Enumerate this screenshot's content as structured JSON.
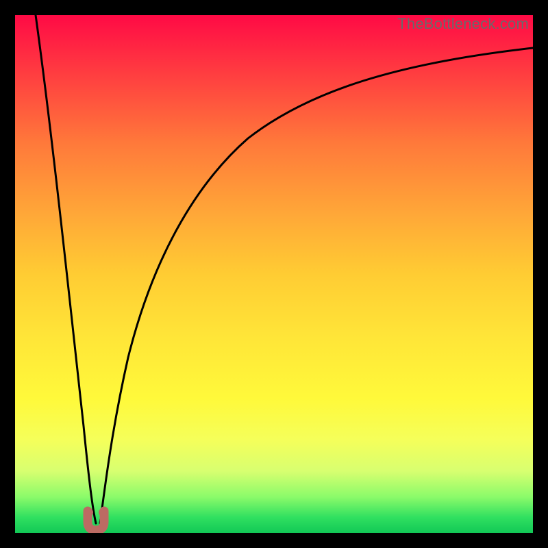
{
  "attribution": "TheBottleneck.com",
  "chart_data": {
    "type": "line",
    "title": "",
    "xlabel": "",
    "ylabel": "",
    "xlim": [
      0,
      100
    ],
    "ylim": [
      0,
      100
    ],
    "notch_x": 15,
    "series": [
      {
        "name": "left-curve",
        "x": [
          4,
          6,
          8,
          10,
          12,
          13,
          14,
          15
        ],
        "values": [
          100,
          82,
          64,
          46,
          28,
          16,
          6,
          1
        ]
      },
      {
        "name": "right-curve",
        "x": [
          15,
          16,
          17,
          19,
          22,
          26,
          32,
          40,
          50,
          62,
          76,
          90,
          100
        ],
        "values": [
          1,
          6,
          16,
          32,
          48,
          60,
          70,
          78,
          84,
          88,
          91,
          93,
          94
        ]
      }
    ],
    "notch_marker": {
      "shape": "u",
      "color": "#bc6b63",
      "x": 15,
      "y": 2,
      "width": 4,
      "height": 4
    }
  }
}
